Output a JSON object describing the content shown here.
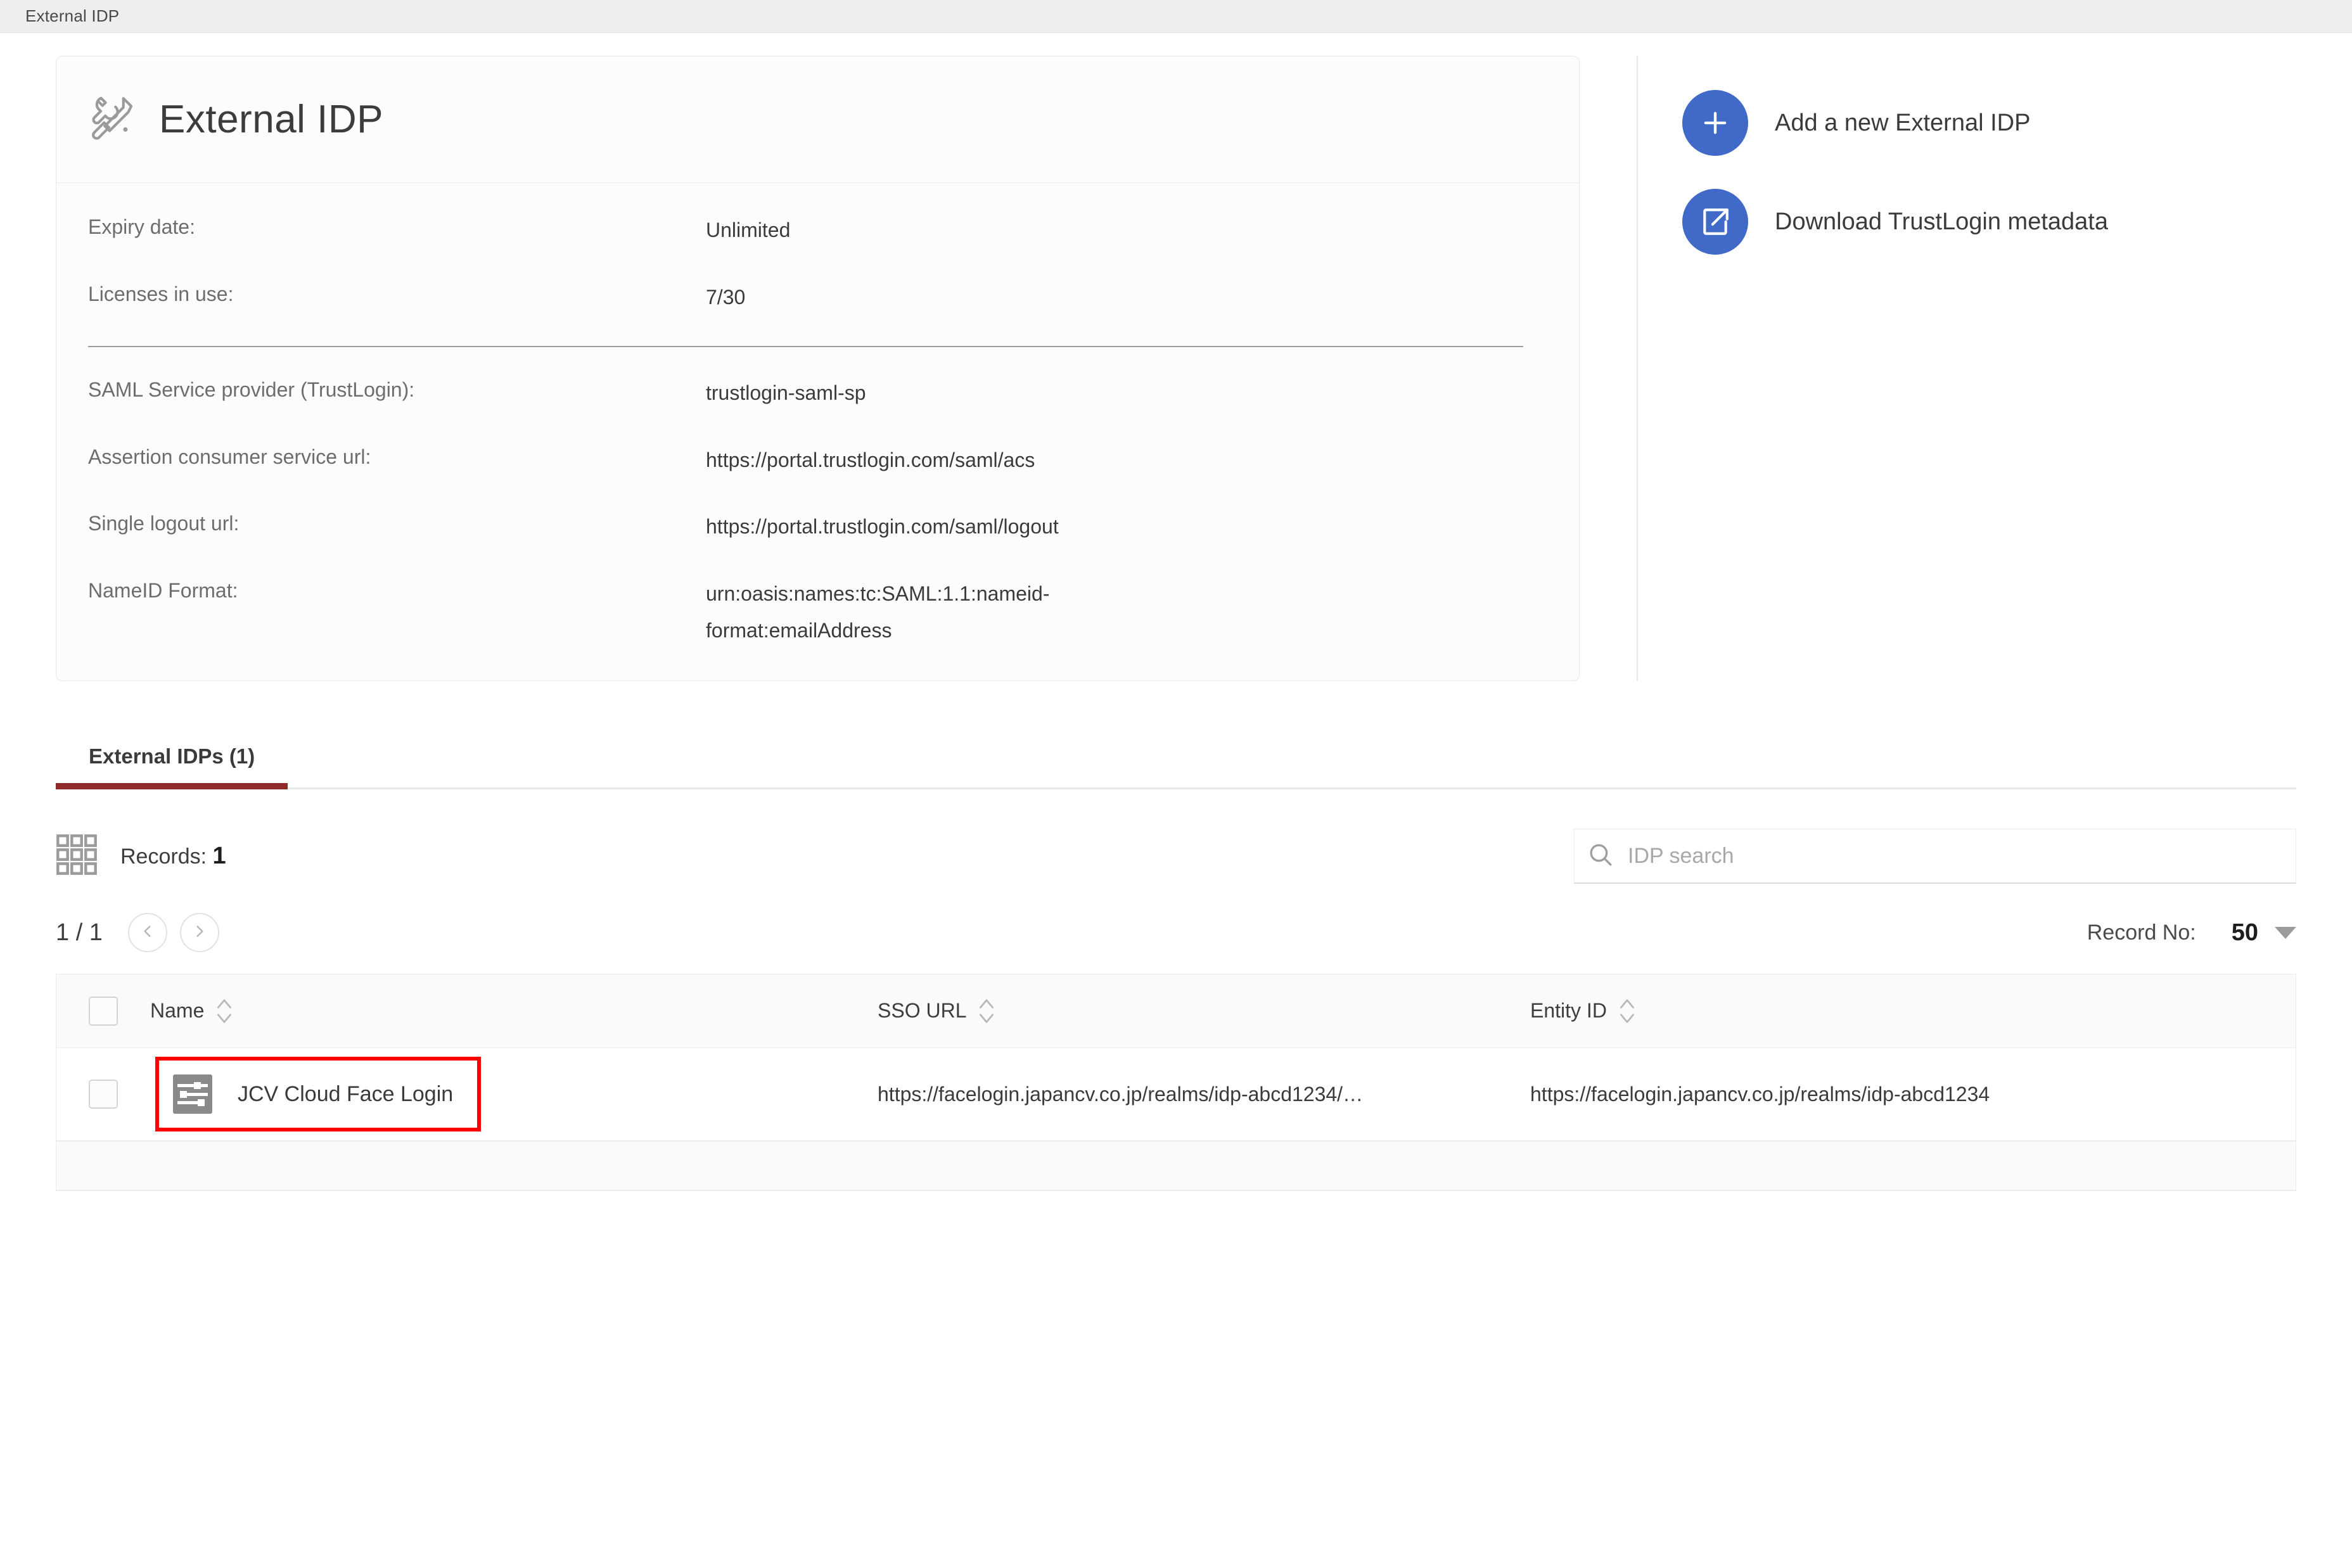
{
  "breadcrumb": {
    "title": "External IDP"
  },
  "card": {
    "icon": "tools-icon",
    "title": "External IDP",
    "fields": [
      {
        "label": "Expiry date:",
        "value": "Unlimited"
      },
      {
        "label": "Licenses in use:",
        "value": "7/30"
      },
      {
        "label": "SAML Service provider (TrustLogin):",
        "value": "trustlogin-saml-sp"
      },
      {
        "label": "Assertion consumer service url:",
        "value": "https://portal.trustlogin.com/saml/acs"
      },
      {
        "label": "Single logout url:",
        "value": "https://portal.trustlogin.com/saml/logout"
      },
      {
        "label": "NameID Format:",
        "value": "urn:oasis:names:tc:SAML:1.1:nameid-format:emailAddress"
      }
    ]
  },
  "actions": [
    {
      "icon": "plus-icon",
      "label": "Add a new External IDP"
    },
    {
      "icon": "external-link-icon",
      "label": "Download TrustLogin metadata"
    }
  ],
  "tabs": [
    {
      "label": "External IDPs (1)",
      "active": true
    }
  ],
  "records": {
    "icon": "grid-icon",
    "label": "Records:",
    "count": "1"
  },
  "search": {
    "icon": "search-icon",
    "placeholder": "IDP search",
    "value": ""
  },
  "pagination": {
    "page_indicator": "1 / 1",
    "prev_icon": "chevron-left-icon",
    "next_icon": "chevron-right-icon",
    "record_no_label": "Record No:",
    "record_no_value": "50",
    "caret_icon": "chevron-down-icon"
  },
  "table": {
    "columns": [
      {
        "label": "Name"
      },
      {
        "label": "SSO URL"
      },
      {
        "label": "Entity ID"
      }
    ],
    "rows": [
      {
        "icon": "sliders-icon",
        "name": "JCV Cloud Face Login",
        "sso_url": "https://facelogin.japancv.co.jp/realms/idp-abcd1234/…",
        "entity_id": "https://facelogin.japancv.co.jp/realms/idp-abcd1234",
        "highlighted": true
      }
    ]
  },
  "colors": {
    "accent_blue": "#4169c7",
    "tab_underline": "#8e2a2a",
    "highlight_red": "#ff0000",
    "topbar_bg": "#eeeeee"
  }
}
